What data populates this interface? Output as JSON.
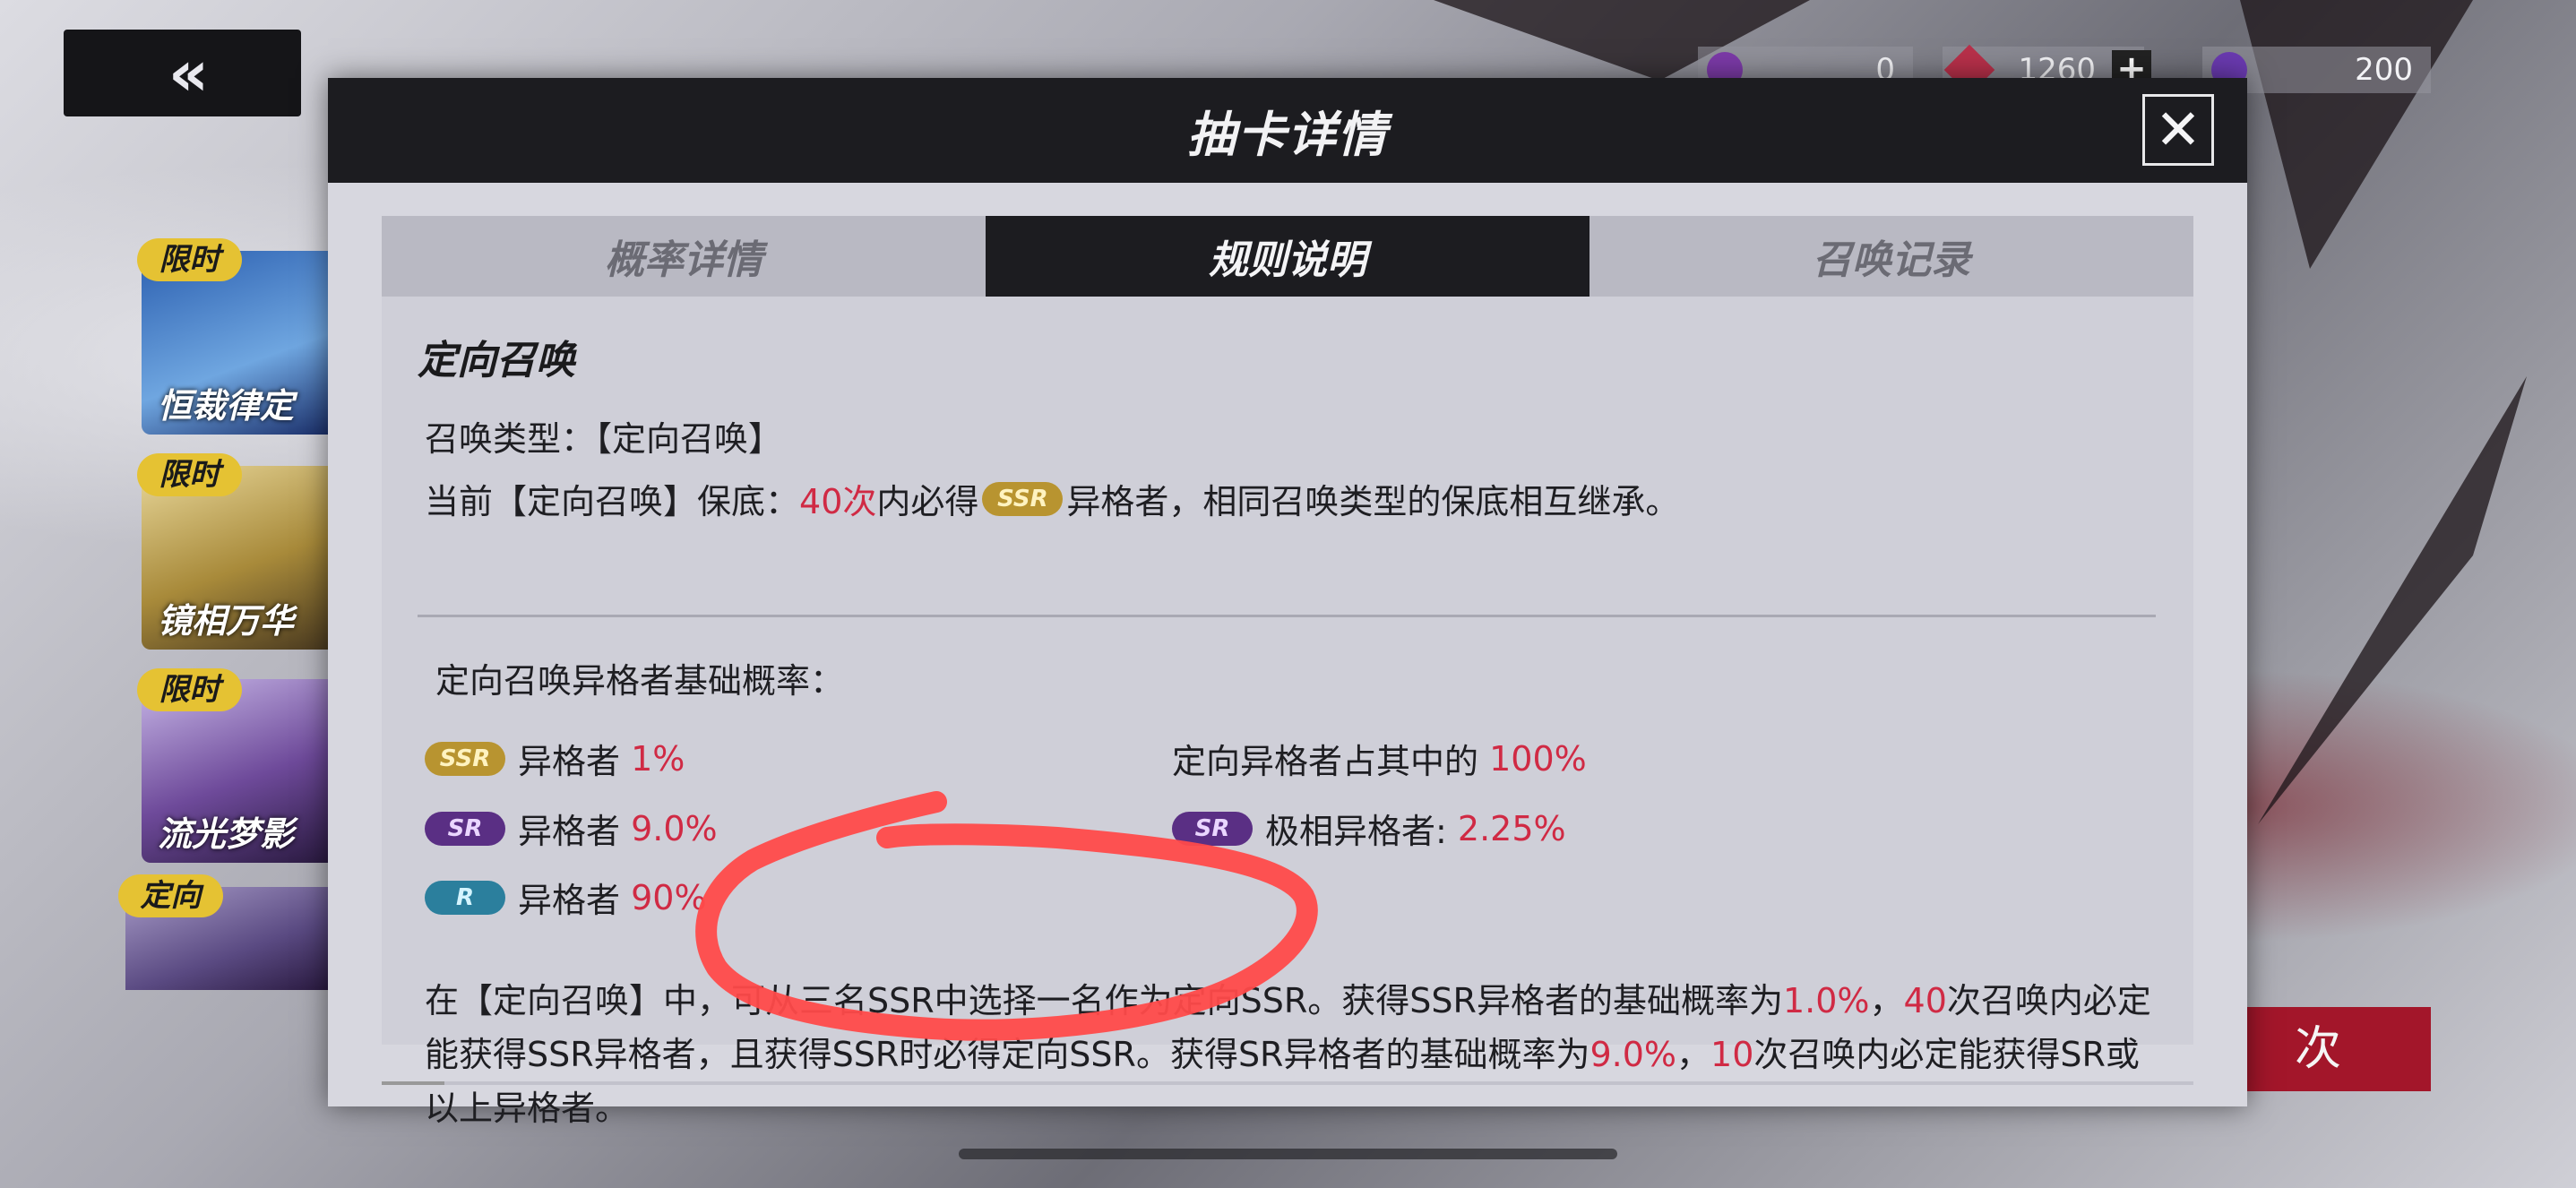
{
  "nav": {
    "back_icon": "«"
  },
  "currency": [
    {
      "icon": "purple-gem-icon",
      "value": "0",
      "color": "#7c3aa8"
    },
    {
      "icon": "red-crystal-icon",
      "value": "1260",
      "color": "#b8304a",
      "plus": "+"
    },
    {
      "icon": "purple-orb-icon",
      "value": "200",
      "color": "#6a3ab0"
    }
  ],
  "banners": [
    {
      "tag": "限时",
      "name": "恒裁律定"
    },
    {
      "tag": "限时",
      "name": "镜相万华"
    },
    {
      "tag": "限时",
      "name": "流光梦影"
    },
    {
      "tag": "定向",
      "name": ""
    }
  ],
  "cta": {
    "label": "次"
  },
  "modal": {
    "title": "抽卡详情",
    "close_icon": "✕",
    "tabs": [
      {
        "label": "概率详情"
      },
      {
        "label": "规则说明"
      },
      {
        "label": "召唤记录"
      }
    ],
    "active_tab": "规则说明",
    "section_title": "定向召唤",
    "summon_type_label": "召唤类型：",
    "summon_type_value": "【定向召唤】",
    "pity_prefix": "当前【定向召唤】保底：",
    "pity_count": "40次",
    "pity_mid": "内必得",
    "pity_suffix": "异格者，相同召唤类型的保底相互继承。",
    "base_rate_title": "定向召唤异格者基础概率：",
    "rates": [
      {
        "badge": "SSR",
        "label": "异格者",
        "value": "1%"
      },
      {
        "badge": "SR",
        "label": "异格者",
        "value": "9.0%"
      },
      {
        "badge": "R",
        "label": "异格者",
        "value": "90%"
      }
    ],
    "rates_right": [
      {
        "badge": "",
        "label": "定向异格者占其中的",
        "value": "100%"
      },
      {
        "badge": "SR",
        "label": "极相异格者:",
        "value": "2.25%"
      }
    ],
    "para": {
      "p1": "在【定向召唤】中，可从三名SSR中选择一名作为定向SSR。获得SSR异格者的基础概率为",
      "v1": "1.0%",
      "p2": "，",
      "v2": "40",
      "p3": "次召唤内必定能获得SSR异格者，且获得SSR时必得定向SSR。获得SR异格者的基础概率为",
      "v3": "9.0%",
      "p4": "，",
      "v4": "10",
      "p5": "次召唤内必定能获得SR或以上异格者。"
    }
  },
  "colors": {
    "accent_red": "#d02a44",
    "annotation_red": "#ff4a4a",
    "header_dark": "#1c1c20"
  }
}
